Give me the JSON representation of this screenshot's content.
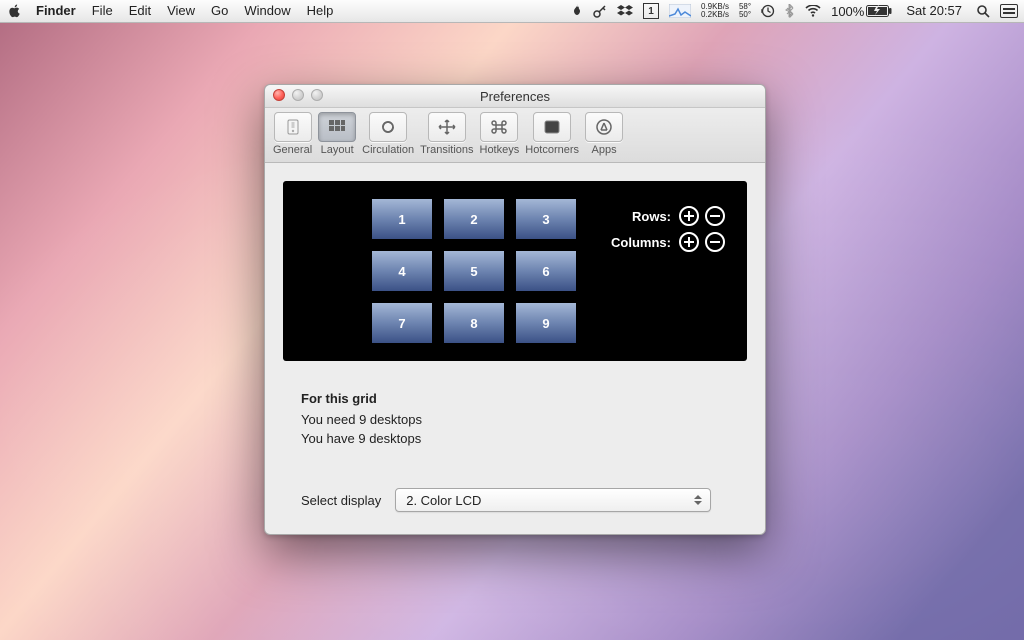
{
  "menubar": {
    "app": "Finder",
    "items": [
      "File",
      "Edit",
      "View",
      "Go",
      "Window",
      "Help"
    ],
    "status": {
      "net_up": "0.9KB/s",
      "net_down": "0.2KB/s",
      "temp1": "58°",
      "temp2": "50°",
      "battery_pct": "100%",
      "clock": "Sat 20:57",
      "dropbox_badge": "1"
    }
  },
  "window": {
    "title": "Preferences",
    "toolbar": [
      {
        "id": "general",
        "label": "General",
        "selected": false
      },
      {
        "id": "layout",
        "label": "Layout",
        "selected": true
      },
      {
        "id": "circulation",
        "label": "Circulation",
        "selected": false
      },
      {
        "id": "transitions",
        "label": "Transitions",
        "selected": false
      },
      {
        "id": "hotkeys",
        "label": "Hotkeys",
        "selected": false
      },
      {
        "id": "hotcorners",
        "label": "Hotcorners",
        "selected": false
      },
      {
        "id": "apps",
        "label": "Apps",
        "selected": false
      }
    ],
    "grid": {
      "cells": [
        "1",
        "2",
        "3",
        "4",
        "5",
        "6",
        "7",
        "8",
        "9"
      ],
      "rows_label": "Rows:",
      "cols_label": "Columns:"
    },
    "info": {
      "heading": "For this grid",
      "line1": "You need 9 desktops",
      "line2": "You have 9 desktops"
    },
    "display_select": {
      "label": "Select display",
      "value": "2. Color LCD"
    }
  }
}
